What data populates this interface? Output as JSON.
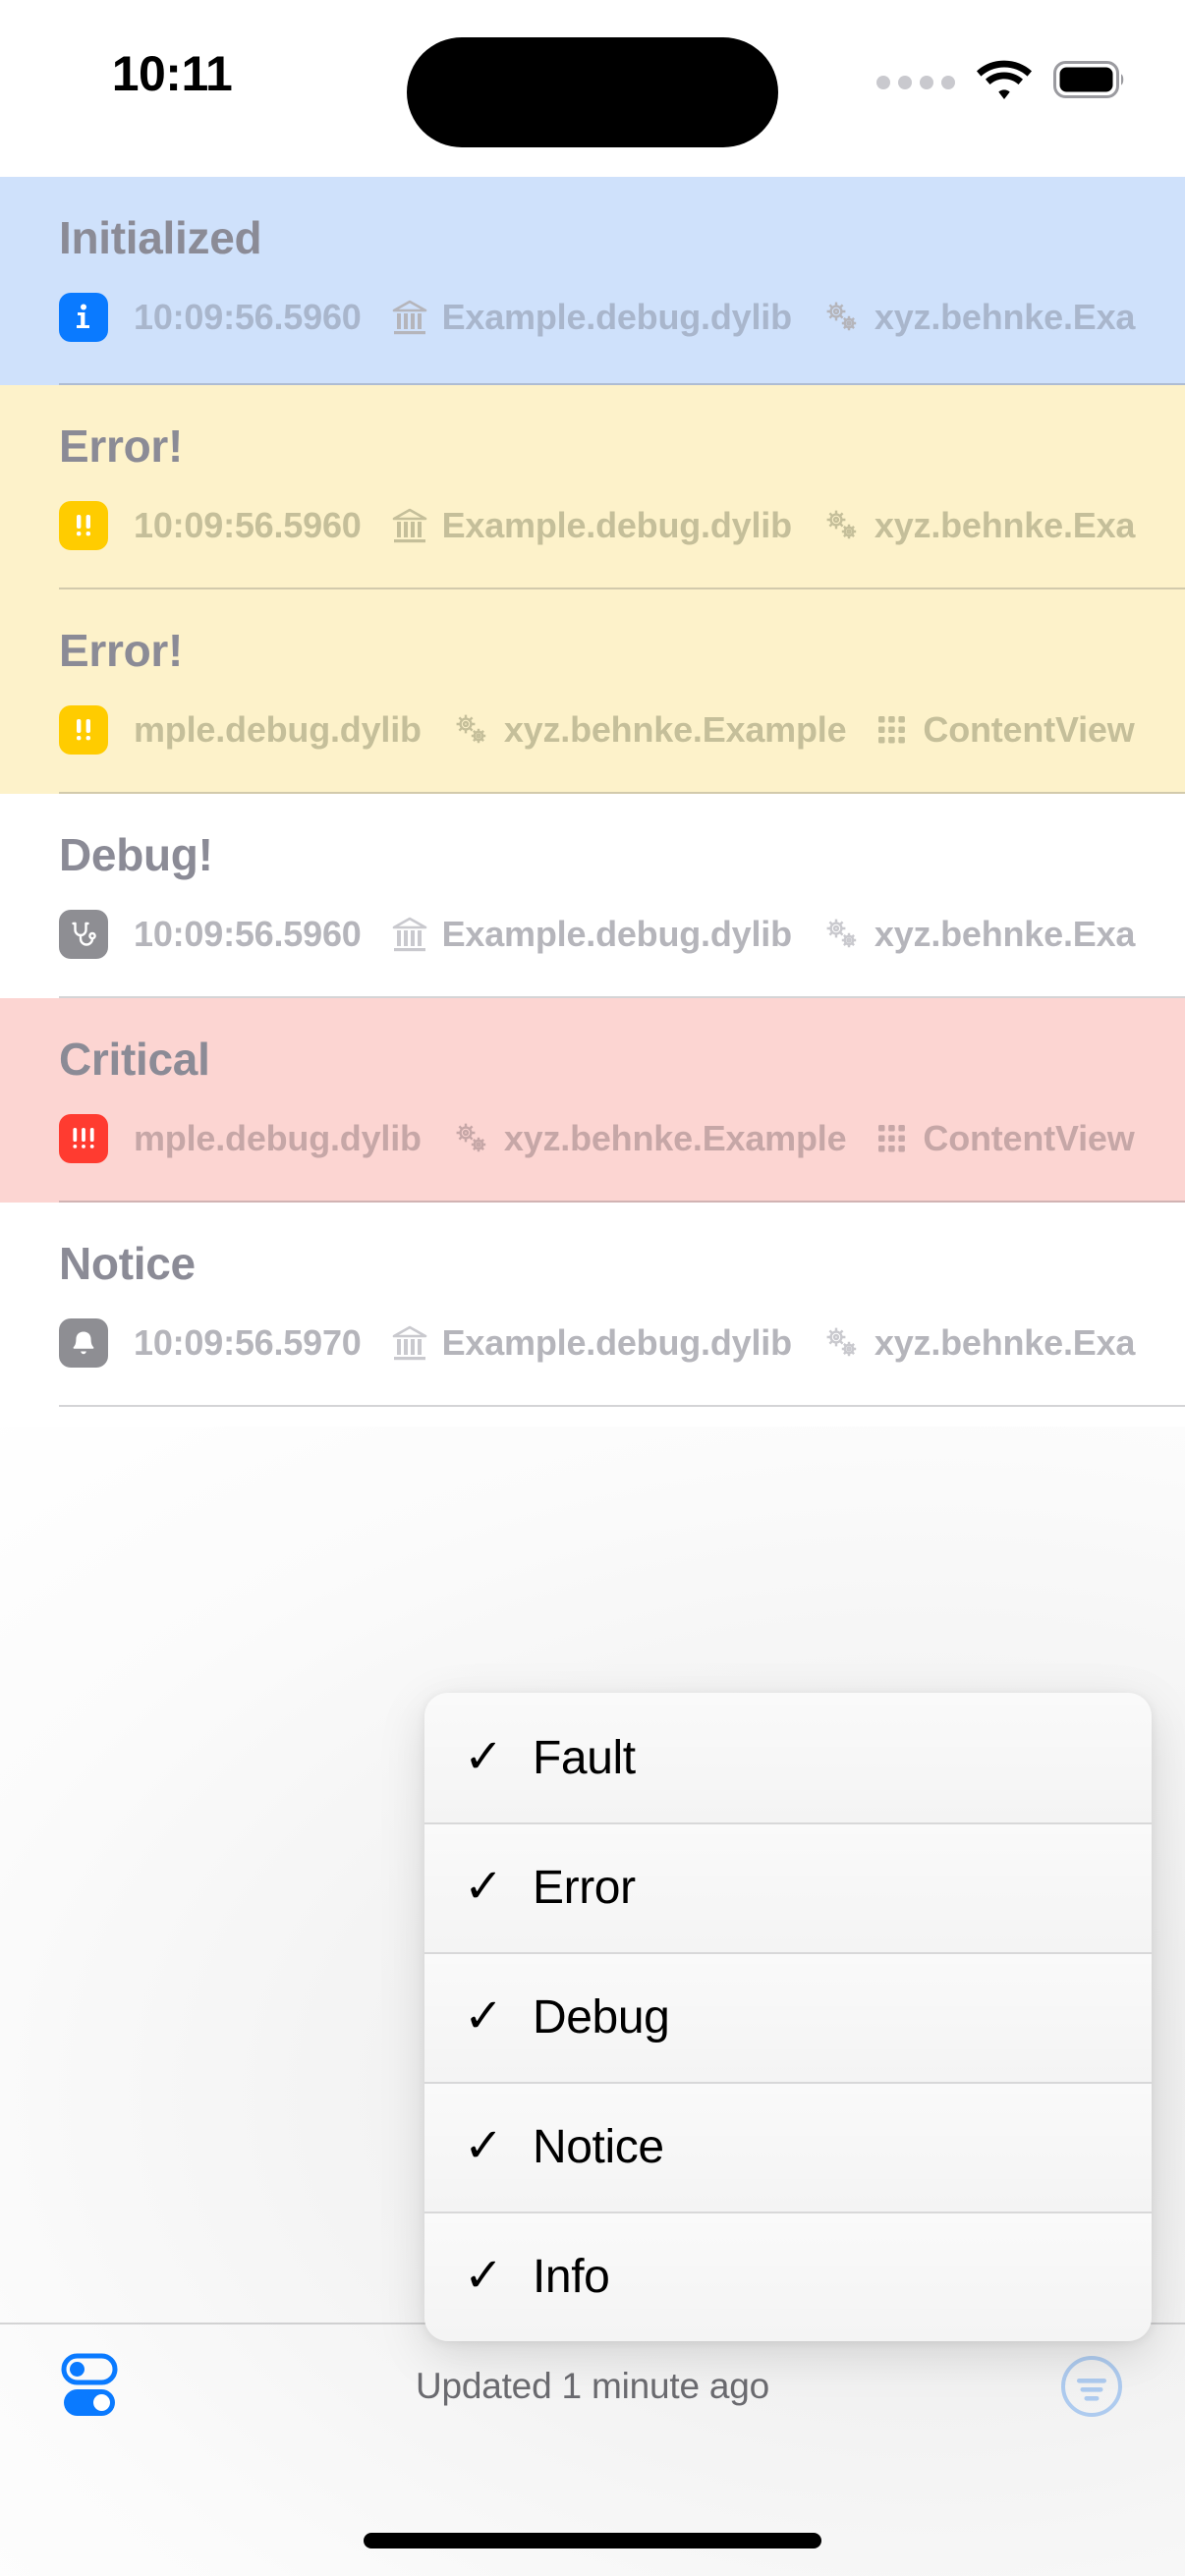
{
  "status_bar": {
    "time": "10:11",
    "cellular_icon": "cellular-dots-icon",
    "wifi_icon": "wifi-icon",
    "battery_icon": "battery-icon",
    "dynamic_island": "dynamic-island"
  },
  "log_rows": [
    {
      "title": "Initialized",
      "level": "info",
      "badge_icon": "info-badge-icon",
      "tint": "blue",
      "tint_color": "#cfe1fb",
      "badge_color": "#0a7aff",
      "timestamp": "10:09:56.5960",
      "library": "Example.debug.dylib",
      "library_icon": "building-columns-icon",
      "subsystem": "xyz.behnke.Exa",
      "subsystem_icon": "gears-icon",
      "category": "",
      "category_icon": "",
      "truncated": true
    },
    {
      "title": "Error!",
      "level": "error",
      "badge_icon": "error-badge-icon",
      "tint": "yellow",
      "tint_color": "#fdf2ca",
      "badge_color": "#ffcc00",
      "timestamp": "10:09:56.5960",
      "library": "Example.debug.dylib",
      "library_icon": "building-columns-icon",
      "subsystem": "xyz.behnke.Exa",
      "subsystem_icon": "gears-icon",
      "category": "",
      "category_icon": "",
      "truncated": true
    },
    {
      "title": "Error!",
      "level": "error",
      "badge_icon": "error-badge-icon",
      "tint": "yellow",
      "tint_color": "#fdf2ca",
      "badge_color": "#ffcc00",
      "timestamp": "",
      "library": "mple.debug.dylib",
      "library_icon": "",
      "subsystem": "xyz.behnke.Example",
      "subsystem_icon": "gears-icon",
      "category": "ContentView",
      "category_icon": "grid-icon",
      "truncated": false
    },
    {
      "title": "Debug!",
      "level": "debug",
      "badge_icon": "stethoscope-badge-icon",
      "tint": "none",
      "tint_color": "#ffffff",
      "badge_color": "#8e8e93",
      "timestamp": "10:09:56.5960",
      "library": "Example.debug.dylib",
      "library_icon": "building-columns-icon",
      "subsystem": "xyz.behnke.Exa",
      "subsystem_icon": "gears-icon",
      "category": "",
      "category_icon": "",
      "truncated": true
    },
    {
      "title": "Critical",
      "level": "critical",
      "badge_icon": "critical-badge-icon",
      "tint": "pink",
      "tint_color": "#fcd5d2",
      "badge_color": "#ff3b30",
      "timestamp": "",
      "library": "mple.debug.dylib",
      "library_icon": "",
      "subsystem": "xyz.behnke.Example",
      "subsystem_icon": "gears-icon",
      "category": "ContentView",
      "category_icon": "grid-icon",
      "truncated": false
    },
    {
      "title": "Notice",
      "level": "notice",
      "badge_icon": "bell-badge-icon",
      "tint": "none",
      "tint_color": "#ffffff",
      "badge_color": "#8e8e93",
      "timestamp": "10:09:56.5970",
      "library": "Example.debug.dylib",
      "library_icon": "building-columns-icon",
      "subsystem": "xyz.behnke.Exa",
      "subsystem_icon": "gears-icon",
      "category": "",
      "category_icon": "",
      "truncated": true
    }
  ],
  "context_menu": {
    "items": [
      {
        "label": "Fault",
        "checked": true,
        "check_glyph": "✓"
      },
      {
        "label": "Error",
        "checked": true,
        "check_glyph": "✓"
      },
      {
        "label": "Debug",
        "checked": true,
        "check_glyph": "✓"
      },
      {
        "label": "Notice",
        "checked": true,
        "check_glyph": "✓"
      },
      {
        "label": "Info",
        "checked": true,
        "check_glyph": "✓"
      }
    ]
  },
  "toolbar": {
    "toggles_icon": "switches-toggle-icon",
    "status_text": "Updated 1 minute ago",
    "filter_icon": "filter-circle-icon",
    "accent_color": "#0a7aff",
    "filter_icon_color": "#aecbef"
  }
}
